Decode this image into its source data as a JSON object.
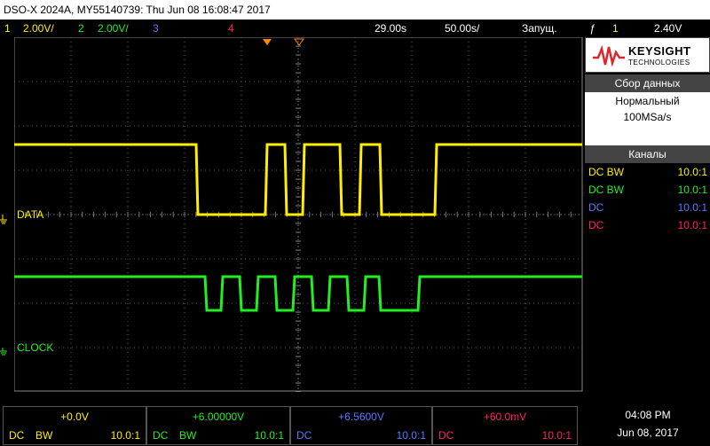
{
  "titlebar": {
    "text": "DSO-X 2024A, MY55140739: Thu Jun 08 16:08:47 2017"
  },
  "status": {
    "ch1_num": "1",
    "ch1_scale": "2.00V/",
    "ch2_num": "2",
    "ch2_scale": "2.00V/",
    "ch3_num": "3",
    "ch4_num": "4",
    "time_delay": "29.00s",
    "time_scale": "50.00s/",
    "run_state": "Запущ.",
    "trig_source": "1",
    "trig_level": "2.40V"
  },
  "screen": {
    "trigger_marker": "T",
    "ch1_label": "DATA",
    "ch1_num": "1",
    "ch2_label": "CLOCK",
    "ch2_num": "2"
  },
  "side": {
    "brand": "KEYSIGHT",
    "brand_sub": "TECHNOLOGIES",
    "acq_header": "Сбор данных",
    "acq_mode": "Нормальный",
    "acq_rate": "100MSa/s",
    "channels_header": "Каналы",
    "channels": [
      {
        "coupling": "DC BW",
        "probe": "10.0:1",
        "color": "#ffee00"
      },
      {
        "coupling": "DC BW",
        "probe": "10.0:1",
        "color": "#22ee22"
      },
      {
        "coupling": "DC",
        "probe": "10.0:1",
        "color": "#5577ff"
      },
      {
        "coupling": "DC",
        "probe": "10.0:1",
        "color": "#ff2266"
      }
    ]
  },
  "bottom": {
    "ch": [
      {
        "value": "+0.0V",
        "c1": "DC",
        "c2": "BW",
        "c3": "10.0:1",
        "color": "#ffee00"
      },
      {
        "value": "+6.00000V",
        "c1": "DC",
        "c2": "BW",
        "c3": "10.0:1",
        "color": "#22ee22"
      },
      {
        "value": "+6.5600V",
        "c1": "DC",
        "c2": "",
        "c3": "10.0:1",
        "color": "#5577ff"
      },
      {
        "value": "+60.0mV",
        "c1": "DC",
        "c2": "",
        "c3": "10.0:1",
        "color": "#ff2266"
      }
    ],
    "time": "04:08 PM",
    "date": "Jun 08, 2017"
  },
  "colors": {
    "ch1": "#ffee00",
    "ch2": "#22ee22",
    "ch3": "#5577ff",
    "ch4": "#ff2266",
    "trigger": "#ff8800"
  }
}
